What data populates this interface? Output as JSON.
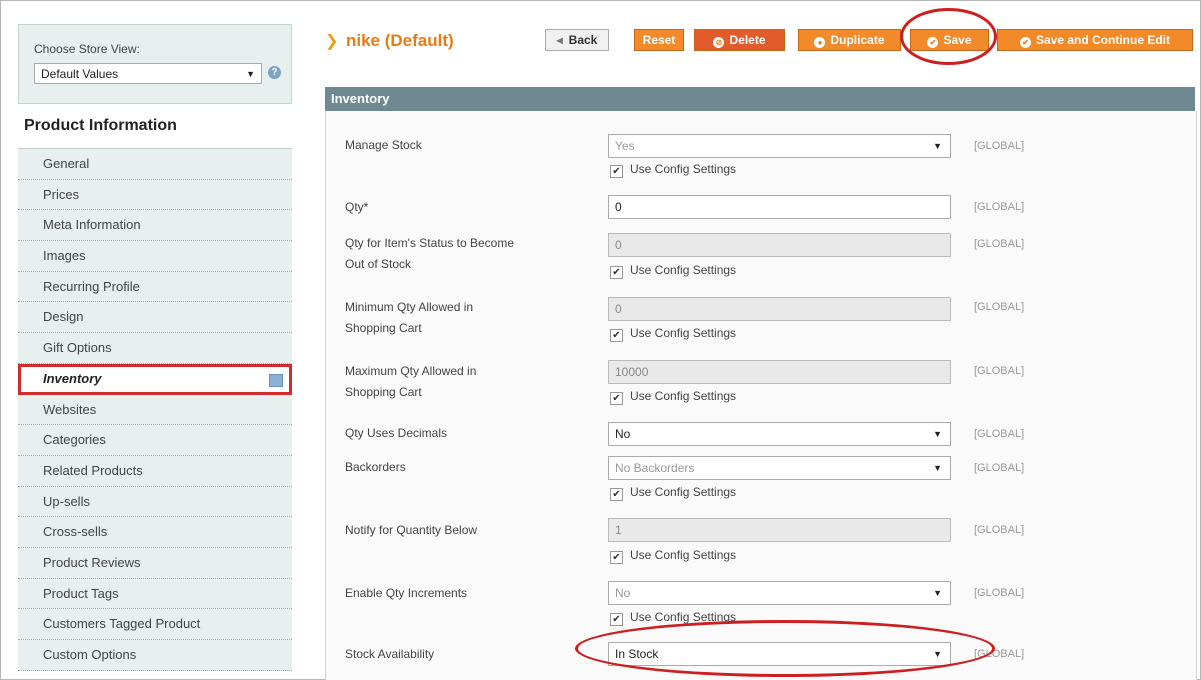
{
  "store": {
    "label": "Choose Store View:",
    "value": "Default Values"
  },
  "sidebar": {
    "title": "Product Information",
    "tabs": [
      "General",
      "Prices",
      "Meta Information",
      "Images",
      "Recurring Profile",
      "Design",
      "Gift Options",
      "Inventory",
      "Websites",
      "Categories",
      "Related Products",
      "Up-sells",
      "Cross-sells",
      "Product Reviews",
      "Product Tags",
      "Customers Tagged Product",
      "Custom Options"
    ],
    "active_tab": "Inventory"
  },
  "header": {
    "title": "nike (Default)",
    "buttons": {
      "back": "Back",
      "reset": "Reset",
      "delete": "Delete",
      "duplicate": "Duplicate",
      "save": "Save",
      "save_continue": "Save and Continue Edit"
    }
  },
  "section": {
    "title": "Inventory"
  },
  "scope_label": "[GLOBAL]",
  "use_config_label": "Use Config Settings",
  "fields": {
    "manage_stock": {
      "label": "Manage Stock",
      "value": "Yes"
    },
    "qty": {
      "label": "Qty*",
      "value": "0"
    },
    "out_of_stock": {
      "label_1": "Qty for Item's Status to Become",
      "label_2": "Out of Stock",
      "value": "0"
    },
    "min_qty": {
      "label_1": "Minimum Qty Allowed in",
      "label_2": "Shopping Cart",
      "value": "0"
    },
    "max_qty": {
      "label_1": "Maximum Qty Allowed in",
      "label_2": "Shopping Cart",
      "value": "10000"
    },
    "decimals": {
      "label": "Qty Uses Decimals",
      "value": "No"
    },
    "backorders": {
      "label": "Backorders",
      "value": "No Backorders"
    },
    "notify": {
      "label": "Notify for Quantity Below",
      "value": "1"
    },
    "increments": {
      "label": "Enable Qty Increments",
      "value": "No"
    },
    "availability": {
      "label": "Stock Availability",
      "value": "In Stock"
    }
  },
  "colors": {
    "accent": "#f28a2a",
    "section_bar": "#6f8992",
    "highlight": "#cc2020"
  }
}
